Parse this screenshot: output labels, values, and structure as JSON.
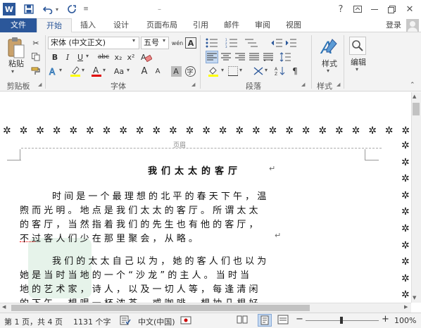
{
  "title_bar": {
    "window_title": "–",
    "help": "?",
    "restore_label": "Restore Down"
  },
  "tabs": [
    "文件",
    "开始",
    "插入",
    "设计",
    "页面布局",
    "引用",
    "邮件",
    "审阅",
    "视图"
  ],
  "account": "登录",
  "ribbon": {
    "clipboard": {
      "paste": "粘贴",
      "group": "剪贴板"
    },
    "font": {
      "name": "宋体 (中文正文)",
      "size": "五号",
      "wen": "wén",
      "A_box": "A",
      "bold": "B",
      "italic": "I",
      "underline": "U",
      "strike": "abc",
      "sub": "x₂",
      "sup": "x²",
      "change_case": "Aa",
      "grow": "A",
      "shrink": "A",
      "group": "字体"
    },
    "paragraph": {
      "group": "段落"
    },
    "styles": {
      "label": "样式",
      "group": "样式"
    },
    "editing": {
      "label": "编辑"
    }
  },
  "document": {
    "header_mark": "页眉",
    "title": "我们太太的客厅",
    "para_mark": "↵",
    "para1": [
      "时 间 是 一 个 最 理 想 的 北 平 的 春 天 下 午 ， 温",
      "煦 而 光 明 。 地 点 是 我 们 太 太 的 客 厅 。 所 谓 太 太",
      "的 客 厅 ， 当 然 指 着 我 们 的 先 生 也 有 他 的 客 厅 ，",
      "不 过 客 人 们 少 在 那 里 聚 会 ， 从 略 。"
    ],
    "para2": [
      "我 们 的 太 太 自 己 以 为 ， 她 的 客 人 们 也 以 为",
      "她 是 当 时 当 地 的 一 个 “ 沙 龙 ” 的 主 人 。 当 时 当",
      "地 的 艺 术 家 ， 诗 人 ， 以 及 一 切 人 等 ， 每 逢 清 闲",
      "的 下 午 ， 想 喝 一 杯 浓 茶 ， 或 咖 啡 ， 想 抽 几 根 好"
    ]
  },
  "status": {
    "page": "第 1 页，共 4 页",
    "words": "1131 个字",
    "language": "中文(中国)",
    "zoom": "100%",
    "minus": "−",
    "plus": "+"
  }
}
